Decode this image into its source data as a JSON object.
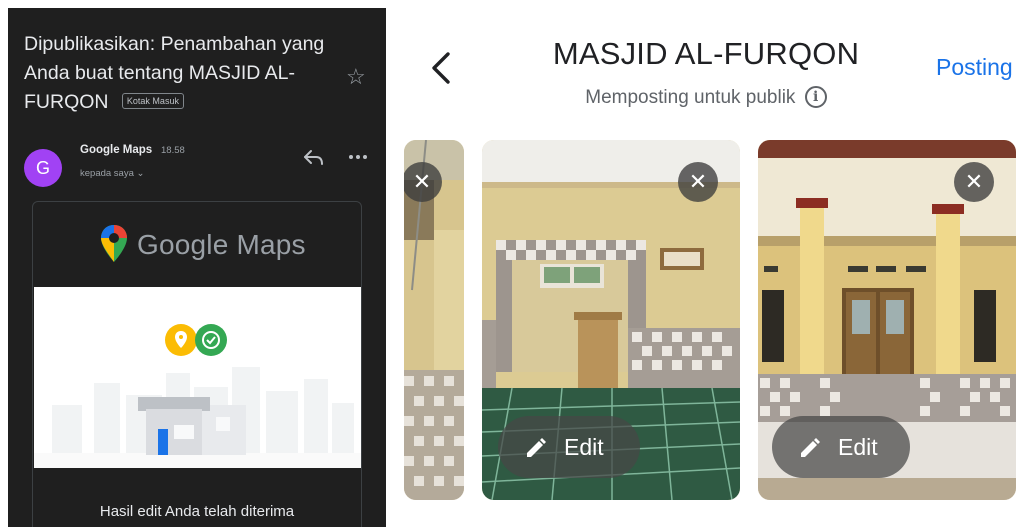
{
  "email": {
    "subject": "Dipublikasikan: Penambahan yang Anda buat tentang MASJID AL-FURQON",
    "label": "Kotak Masuk",
    "avatar_letter": "G",
    "sender": "Google Maps",
    "time": "18.58",
    "recipient": "kepada saya ⌄",
    "logo_text": "Google Maps",
    "body_text": "Hasil edit Anda telah diterima"
  },
  "post": {
    "title": "MASJID AL-FURQON",
    "subtitle": "Memposting untuk publik",
    "post_label": "Posting",
    "photos": [
      {
        "close": "✕",
        "edit_label": ""
      },
      {
        "close": "✕",
        "edit_label": "Edit"
      },
      {
        "close": "✕",
        "edit_label": "Edit"
      }
    ]
  },
  "colors": {
    "avatar": "#a142f4",
    "accent_blue": "#1a73e8",
    "dark_bg": "#1f1f1f",
    "map_pin_yellow": "#fbbc04",
    "check_green": "#34a853"
  },
  "icons": [
    "star-icon",
    "reply-icon",
    "more-icon",
    "maps-pin-icon",
    "back-chevron-icon",
    "info-icon",
    "close-icon",
    "pencil-icon"
  ]
}
